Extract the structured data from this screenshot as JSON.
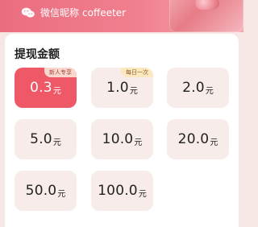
{
  "banner": {
    "wechat_nickname_label": "微信昵称",
    "wechat_nickname_value": "coffeeter"
  },
  "withdraw": {
    "section_title": "提现金额",
    "unit": "元",
    "options": [
      {
        "value": "0.3",
        "badge": "新人专享",
        "selected": true
      },
      {
        "value": "1.0",
        "badge": "每日一次",
        "selected": false
      },
      {
        "value": "2.0",
        "badge": "",
        "selected": false
      },
      {
        "value": "5.0",
        "badge": "",
        "selected": false
      },
      {
        "value": "10.0",
        "badge": "",
        "selected": false
      },
      {
        "value": "20.0",
        "badge": "",
        "selected": false
      },
      {
        "value": "50.0",
        "badge": "",
        "selected": false
      },
      {
        "value": "100.0",
        "badge": "",
        "selected": false
      }
    ]
  },
  "colors": {
    "accent": "#ef5867",
    "card_bg": "#f7ece9",
    "badge_bg": "#fce8bf"
  },
  "icons": {
    "wechat": "wechat-icon"
  }
}
